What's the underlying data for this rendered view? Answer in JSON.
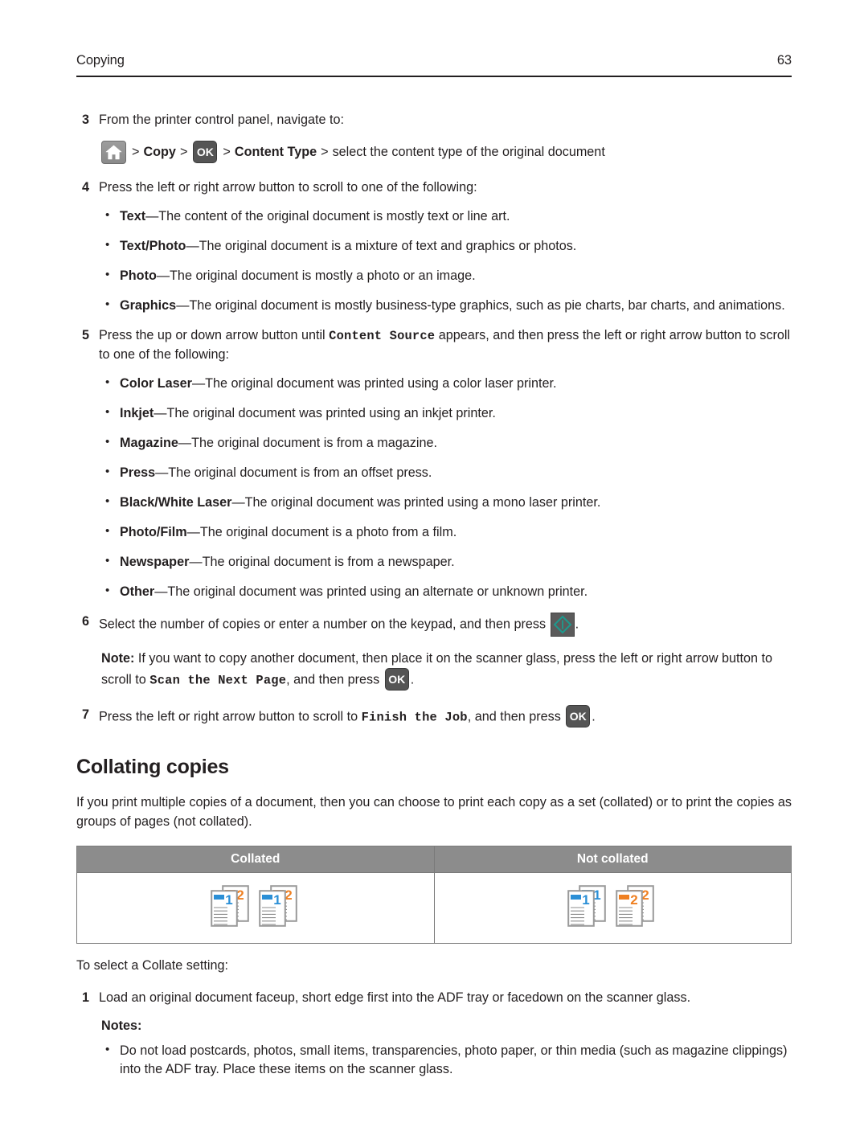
{
  "header": {
    "title": "Copying",
    "page_number": "63"
  },
  "steps": {
    "step3": {
      "number": "3",
      "text": "From the printer control panel, navigate to:"
    },
    "navpath": {
      "home_icon": "home-icon",
      "sep": ">",
      "copy_label": "Copy",
      "ok_icon": "OK",
      "content_type_label": "Content Type",
      "tail": "select the content type of the original document"
    },
    "step4": {
      "number": "4",
      "text": "Press the left or right arrow button to scroll to one of the following:"
    },
    "step5": {
      "number": "5",
      "text_before": "Press the up or down arrow button until ",
      "mono": "Content Source",
      "text_after": " appears, and then press the left or right arrow button to scroll to one of the following:"
    },
    "step6": {
      "number": "6",
      "text_before": "Select the number of copies or enter a number on the keypad, and then press ",
      "text_after": "."
    },
    "note": {
      "label": "Note:",
      "text_before": " If you want to copy another document, then place it on the scanner glass, press the left or right arrow button to scroll to ",
      "mono": "Scan the Next Page",
      "text_mid": ", and then press ",
      "text_after": "."
    },
    "step7": {
      "number": "7",
      "text_before": "Press the left or right arrow button to scroll to ",
      "mono": "Finish the Job",
      "text_mid": ", and then press ",
      "text_after": "."
    }
  },
  "content_type_bullets": [
    {
      "term": "Text",
      "dash": "—",
      "desc": "The content of the original document is mostly text or line art."
    },
    {
      "term": "Text/Photo",
      "dash": "—",
      "desc": "The original document is a mixture of text and graphics or photos."
    },
    {
      "term": "Photo",
      "dash": "—",
      "desc": "The original document is mostly a photo or an image."
    },
    {
      "term": "Graphics",
      "dash": "—",
      "desc": "The original document is mostly business-type graphics, such as pie charts, bar charts, and animations."
    }
  ],
  "content_source_bullets": [
    {
      "term": "Color Laser",
      "dash": "—",
      "desc": "The original document was printed using a color laser printer."
    },
    {
      "term": "Inkjet",
      "dash": "—",
      "desc": "The original document was printed using an inkjet printer."
    },
    {
      "term": "Magazine",
      "dash": "—",
      "desc": "The original document is from a magazine."
    },
    {
      "term": "Press",
      "dash": "—",
      "desc": "The original document is from an offset press."
    },
    {
      "term": "Black/White Laser",
      "dash": "—",
      "desc": "The original document was printed using a mono laser printer."
    },
    {
      "term": "Photo/Film",
      "dash": "—",
      "desc": "The original document is a photo from a film."
    },
    {
      "term": "Newspaper",
      "dash": "—",
      "desc": "The original document is from a newspaper."
    },
    {
      "term": "Other",
      "dash": "—",
      "desc": "The original document was printed using an alternate or unknown printer."
    }
  ],
  "collating_section": {
    "heading": "Collating copies",
    "intro": "If you print multiple copies of a document, then you can choose to print each copy as a set (collated) or to print the copies as groups of pages (not collated).",
    "table": {
      "headers": [
        "Collated",
        "Not collated"
      ],
      "collated_pages": [
        "1",
        "2",
        "1",
        "2"
      ],
      "not_collated_pages": [
        "1",
        "1",
        "2",
        "2"
      ]
    },
    "lead_in": "To select a Collate setting:",
    "step1": {
      "number": "1",
      "text": "Load an original document faceup, short edge first into the ADF tray or facedown on the scanner glass."
    },
    "notes_label": "Notes:",
    "notes": [
      "Do not load postcards, photos, small items, transparencies, photo paper, or thin media (such as magazine clippings) into the ADF tray. Place these items on the scanner glass."
    ]
  },
  "colors": {
    "page_one_accent": "#2b8fd6",
    "page_two_accent": "#ef8022",
    "table_header_bg": "#8c8c8c",
    "button_gray": "#555555",
    "start_teal": "#1d9a8e"
  }
}
